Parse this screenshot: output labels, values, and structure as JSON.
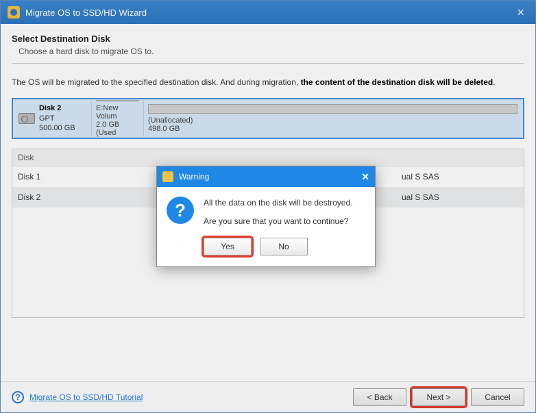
{
  "titlebar": {
    "title": "Migrate OS to SSD/HD Wizard"
  },
  "header": {
    "title": "Select Destination Disk",
    "subtitle": "Choose a hard disk to migrate OS to."
  },
  "warning_prefix": "The OS will be migrated to the specified destination disk. And during migration, ",
  "warning_bold": "the content of the destination disk will be deleted",
  "selected_disk": {
    "name": "Disk 2",
    "scheme": "GPT",
    "size": "500.00 GB",
    "partitions": [
      {
        "label": "E:New Volum",
        "detail": "2.0 GB (Used"
      },
      {
        "label": "(Unallocated)",
        "detail": "498.0 GB"
      }
    ]
  },
  "table": {
    "header": "Disk",
    "rows": [
      {
        "name": "Disk 1",
        "tail": "ual S SAS"
      },
      {
        "name": "Disk 2",
        "tail": "ual S SAS"
      }
    ]
  },
  "footer": {
    "tutorial": "Migrate OS to SSD/HD Tutorial",
    "back": "< Back",
    "next": "Next >",
    "cancel": "Cancel"
  },
  "dialog": {
    "title": "Warning",
    "line1": "All the data on the disk will be destroyed.",
    "line2": "Are you sure that you want to continue?",
    "yes": "Yes",
    "no": "No"
  }
}
